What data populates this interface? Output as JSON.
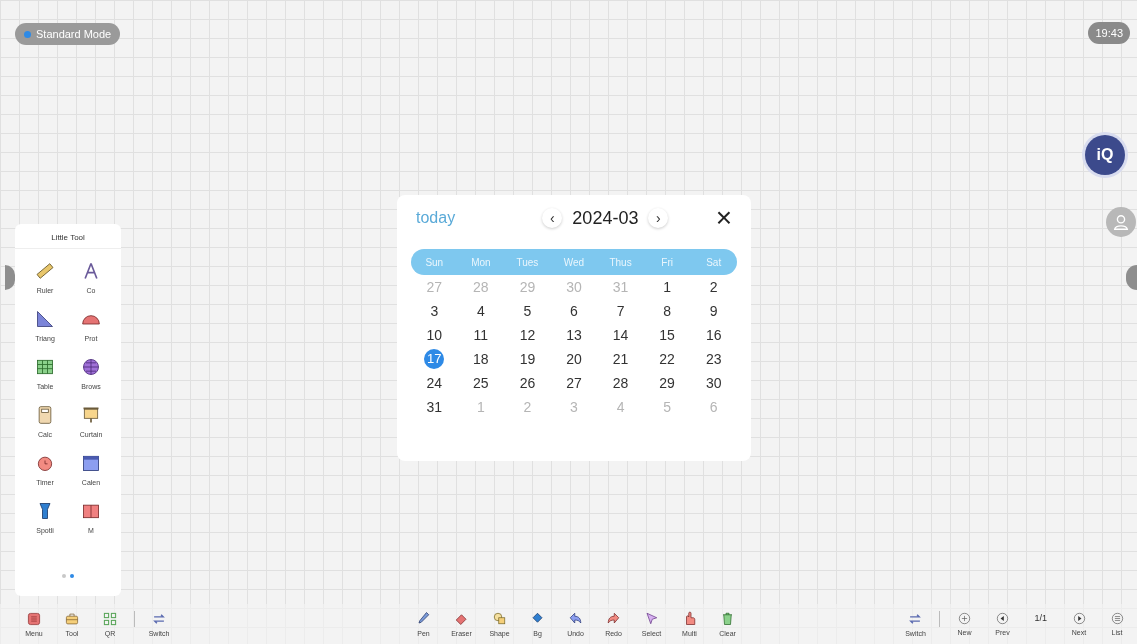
{
  "mode_badge": {
    "label": "Standard Mode"
  },
  "clock": "19:43",
  "side_badge": "iQ",
  "little_tool": {
    "title": "Little Tool",
    "items": [
      {
        "label": "Ruler"
      },
      {
        "label": "Co"
      },
      {
        "label": "Triang"
      },
      {
        "label": "Prot"
      },
      {
        "label": "Table"
      },
      {
        "label": "Brows"
      },
      {
        "label": "Calc"
      },
      {
        "label": "Curtain"
      },
      {
        "label": "Timer"
      },
      {
        "label": "Calen"
      },
      {
        "label": "Spotli"
      },
      {
        "label": "M"
      }
    ],
    "pages": [
      {
        "selected": false
      },
      {
        "selected": true
      }
    ]
  },
  "calendar": {
    "today": "today",
    "prev": "‹",
    "month": "2024-03",
    "next": "›",
    "close": "×",
    "weekdays": [
      "Sun",
      "Mon",
      "Tues",
      "Wed",
      "Thus",
      "Fri",
      "Sat"
    ],
    "weeks": [
      [
        {
          "label": "27",
          "muted": true,
          "selected": false
        },
        {
          "label": "28",
          "muted": true,
          "selected": false
        },
        {
          "label": "29",
          "muted": true,
          "selected": false
        },
        {
          "label": "30",
          "muted": true,
          "selected": false
        },
        {
          "label": "31",
          "muted": true,
          "selected": false
        },
        {
          "label": "1",
          "muted": false,
          "selected": false
        },
        {
          "label": "2",
          "muted": false,
          "selected": false
        }
      ],
      [
        {
          "label": "3",
          "muted": false,
          "selected": false
        },
        {
          "label": "4",
          "muted": false,
          "selected": false
        },
        {
          "label": "5",
          "muted": false,
          "selected": false
        },
        {
          "label": "6",
          "muted": false,
          "selected": false
        },
        {
          "label": "7",
          "muted": false,
          "selected": false
        },
        {
          "label": "8",
          "muted": false,
          "selected": false
        },
        {
          "label": "9",
          "muted": false,
          "selected": false
        }
      ],
      [
        {
          "label": "10",
          "muted": false,
          "selected": false
        },
        {
          "label": "11",
          "muted": false,
          "selected": false
        },
        {
          "label": "12",
          "muted": false,
          "selected": false
        },
        {
          "label": "13",
          "muted": false,
          "selected": false
        },
        {
          "label": "14",
          "muted": false,
          "selected": false
        },
        {
          "label": "15",
          "muted": false,
          "selected": false
        },
        {
          "label": "16",
          "muted": false,
          "selected": false
        }
      ],
      [
        {
          "label": "17",
          "muted": false,
          "selected": true
        },
        {
          "label": "18",
          "muted": false,
          "selected": false
        },
        {
          "label": "19",
          "muted": false,
          "selected": false
        },
        {
          "label": "20",
          "muted": false,
          "selected": false
        },
        {
          "label": "21",
          "muted": false,
          "selected": false
        },
        {
          "label": "22",
          "muted": false,
          "selected": false
        },
        {
          "label": "23",
          "muted": false,
          "selected": false
        }
      ],
      [
        {
          "label": "24",
          "muted": false,
          "selected": false
        },
        {
          "label": "25",
          "muted": false,
          "selected": false
        },
        {
          "label": "26",
          "muted": false,
          "selected": false
        },
        {
          "label": "27",
          "muted": false,
          "selected": false
        },
        {
          "label": "28",
          "muted": false,
          "selected": false
        },
        {
          "label": "29",
          "muted": false,
          "selected": false
        },
        {
          "label": "30",
          "muted": false,
          "selected": false
        }
      ],
      [
        {
          "label": "31",
          "muted": false,
          "selected": false
        },
        {
          "label": "1",
          "muted": true,
          "selected": false
        },
        {
          "label": "2",
          "muted": true,
          "selected": false
        },
        {
          "label": "3",
          "muted": true,
          "selected": false
        },
        {
          "label": "4",
          "muted": true,
          "selected": false
        },
        {
          "label": "5",
          "muted": true,
          "selected": false
        },
        {
          "label": "6",
          "muted": true,
          "selected": false
        }
      ]
    ]
  },
  "toolbar": {
    "left": [
      {
        "label": "Menu"
      },
      {
        "label": "Tool"
      },
      {
        "label": "QR"
      },
      {
        "label": "Switch"
      }
    ],
    "center": [
      {
        "label": "Pen"
      },
      {
        "label": "Eraser"
      },
      {
        "label": "Shape"
      },
      {
        "label": "Bg"
      },
      {
        "label": "Undo"
      },
      {
        "label": "Redo"
      },
      {
        "label": "Select"
      },
      {
        "label": "Multi"
      },
      {
        "label": "Clear"
      }
    ],
    "right": {
      "switch": "Switch",
      "new": "New",
      "prev": "Prev",
      "page": "1/1",
      "next": "Next",
      "list": "List"
    }
  }
}
